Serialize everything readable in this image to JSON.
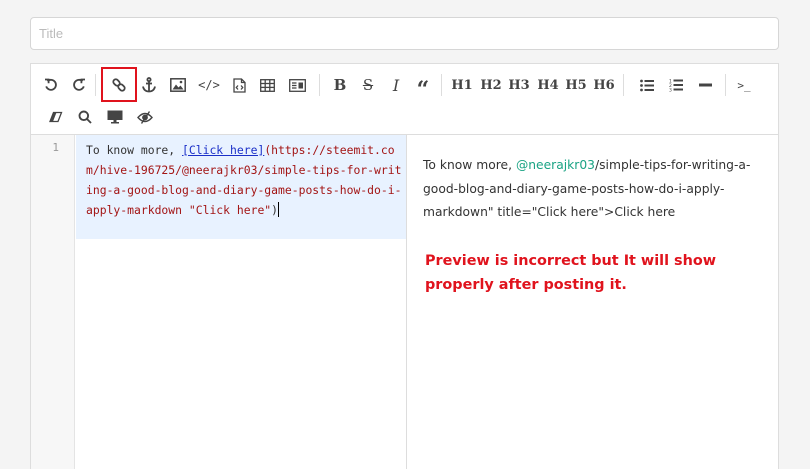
{
  "title_field": {
    "placeholder": "Title",
    "value": ""
  },
  "toolbar": {
    "undo": "Undo",
    "redo": "Redo",
    "link": "Link",
    "anchor": "Anchor",
    "image": "Image",
    "code_inline": "Code",
    "code_block": "Code block",
    "table": "Table",
    "html": "HTML",
    "bold": "B",
    "strikethrough": "S",
    "italic": "I",
    "quote": "“",
    "h1": "H1",
    "h2": "H2",
    "h3": "H3",
    "h4": "H4",
    "h5": "H5",
    "h6": "H6",
    "unordered_list": "Unordered list",
    "ordered_list": "Ordered list",
    "hr": "Horizontal rule",
    "terminal": ">_",
    "clear": "Clear",
    "search": "Search",
    "fullscreen_preview": "Preview",
    "toggle_preview": "Toggle preview",
    "highlighted_tool": "link"
  },
  "editor": {
    "line_number": "1",
    "prefix": "To know more, ",
    "link_text": "[Click here]",
    "url": "(https://steemit.com/hive-196725/@neerajkr03/simple-tips-for-writing-a-good-blog-and-diary-game-posts-how-do-i-apply-markdown ",
    "title_str": "\"Click here\"",
    "close": ")"
  },
  "preview": {
    "prefix": "To know more, ",
    "mention": "@neerajkr03",
    "rest": "/simple-tips-for-writing-a-good-blog-and-diary-game-posts-how-do-i-apply-markdown\" title=\"Click here\">Click here",
    "note": "Preview is incorrect but It will show properly after posting it."
  },
  "colors": {
    "highlight_box": "#e0131d",
    "mention": "#1aa384",
    "note": "#e0131d",
    "active_line": "#e8f2ff"
  }
}
